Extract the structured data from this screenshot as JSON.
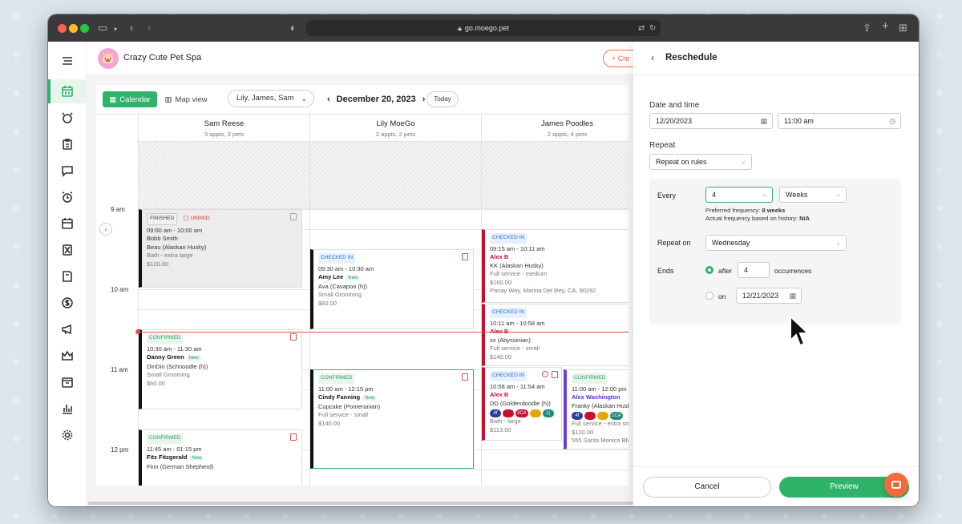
{
  "browser": {
    "url": "go.moego.pet"
  },
  "business": {
    "name": "Crazy Cute Pet Spa"
  },
  "header": {
    "create_label": "+ Cre"
  },
  "toolbar": {
    "calendar_label": "Calendar",
    "map_label": "Map view",
    "staff_value": "Lily, James, Sam",
    "date": "December 20, 2023",
    "today_label": "Today"
  },
  "columns": [
    {
      "name": "Sam Reese",
      "sub": "3 appts, 3 pets"
    },
    {
      "name": "Lily MoeGo",
      "sub": "2 appts, 2 pets"
    },
    {
      "name": "James Poodles",
      "sub": "2 appts, 4 pets"
    }
  ],
  "times": [
    "9 am",
    "10 am",
    "11 am",
    "12 pm"
  ],
  "appointments": [
    {
      "status": "FINISHED",
      "extra": "UNPAID",
      "time": "09:00 am - 10:00 am",
      "client": "Bobb Smith",
      "pet": "Beau (Alaskan Husky)",
      "service": "Bath - extra large",
      "price": "$120.00"
    },
    {
      "status": "CONFIRMED",
      "time": "10:30 am - 11:30 am",
      "client": "Danny Green",
      "tag": "New",
      "pet": "DinDin (Schnoodle (h))",
      "service": "Small Grooming",
      "price": "$60.00"
    },
    {
      "status": "CONFIRMED",
      "time": "11:45 am - 01:15 pm",
      "client": "Fitz Fitzgerald",
      "tag": "New",
      "pet": "Finn (German Shepherd)"
    },
    {
      "status": "CHECKED IN",
      "time": "09:30 am - 10:30 am",
      "client": "Amy Lee",
      "tag": "New",
      "pet": "Ava (Cavapoo (h))",
      "service": "Small Grooming",
      "price": "$60.00"
    },
    {
      "status": "CONFIRMED",
      "time": "11:00 am - 12:15 pm",
      "client": "Cindy Fanning",
      "tag": "New",
      "pet": "Cupcake (Pomeranian)",
      "service": "Full service - small",
      "price": "$140.00"
    },
    {
      "status": "CHECKED IN",
      "time": "09:15 am - 10:11 am",
      "client": "Alex B",
      "pet": "KK (Alaskan Husky)",
      "service": "Full service - medium",
      "price": "$160.00",
      "address": "Panay Way, Marina Del Rey, CA, 90292"
    },
    {
      "status": "CHECKED IN",
      "time": "10:11 am - 10:58 am",
      "client": "Alex B",
      "pet": "xx (Abyssinian)",
      "service": "Full service - small",
      "price": "$140.00"
    },
    {
      "status": "CHECKED IN",
      "time": "10:58 am - 11:54 am",
      "client": "Alex B",
      "pet": "DD (Goldendoodle (h))",
      "chips": [
        "4f",
        "",
        "2CA",
        "",
        "1("
      ],
      "service": "Bath - large",
      "price": "$113.00"
    },
    {
      "status": "CONFIRMED",
      "time": "11:00 am - 12:00 pm",
      "client": "Alex Washington",
      "pet": "Franky (Alaskan Husky",
      "chips": [
        "4f",
        "",
        "",
        "1CA"
      ],
      "service": "Full service - extra sma",
      "price": "$120.00",
      "address": "555 Santa Monica Blvd"
    }
  ],
  "panel": {
    "title": "Reschedule",
    "date_time_label": "Date and time",
    "date_value": "12/20/2023",
    "time_value": "11:00 am",
    "repeat_label": "Repeat",
    "repeat_value": "Repeat on rules",
    "every_label": "Every",
    "every_value": "4",
    "every_unit": "Weeks",
    "preferred_label": "Preferred frequency:",
    "preferred_value": "8 weeks",
    "actual_label": "Actual frequency based on history:",
    "actual_value": "N/A",
    "repeat_on_label": "Repeat on",
    "repeat_on_value": "Wednesday",
    "ends_label": "Ends",
    "after_label": "after",
    "after_value": "4",
    "occurrences_label": "occurrences",
    "on_label": "on",
    "on_value": "12/21/2023",
    "cancel_label": "Cancel",
    "preview_label": "Preview"
  },
  "colors": {
    "accent": "#2fb36b",
    "brand_orange": "#f26b3a",
    "checked_in_red": "#c8102e"
  }
}
